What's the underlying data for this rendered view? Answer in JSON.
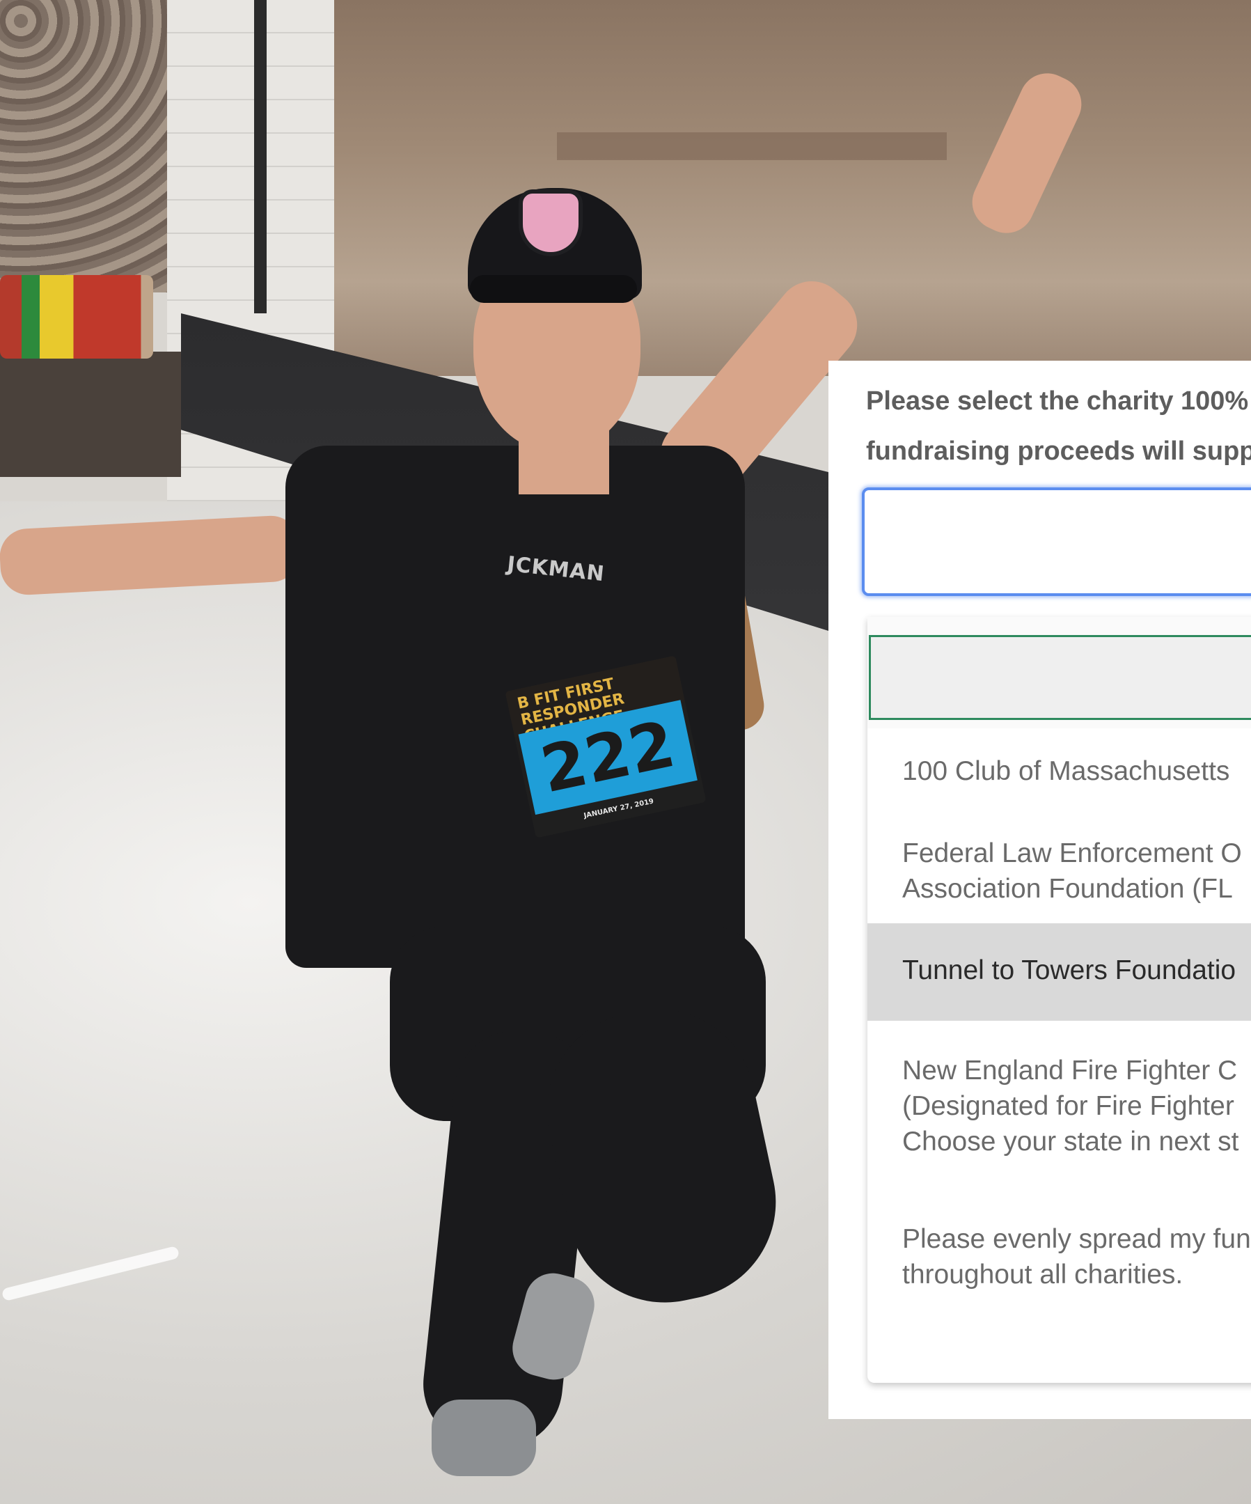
{
  "form": {
    "prompt_line1": "Please select the charity 100%",
    "prompt_line2": "fundraising proceeds will supp",
    "select_value": "",
    "search_value": "",
    "options": [
      "100 Club of Massachusetts",
      "Federal Law Enforcement O\nAssociation Foundation (FL",
      "Tunnel to Towers Foundatio",
      "New England Fire Fighter C\n(Designated for Fire Fighter\nChoose your state in next st",
      "Please evenly spread my fun\nthroughout all charities."
    ],
    "highlighted_index": 2
  },
  "photo": {
    "shirt_text": "JCKMAN",
    "bib_title": "FIRST RESPONDER CHALLENGE",
    "bib_brand": "B FIT",
    "bib_number": "222",
    "bib_date": "JANUARY 27, 2019"
  },
  "colors": {
    "focus_border": "#5b8def",
    "search_border": "#2e8a5e",
    "highlight_bg": "#d9d9d9",
    "bib_blue": "#1f9ed8"
  }
}
